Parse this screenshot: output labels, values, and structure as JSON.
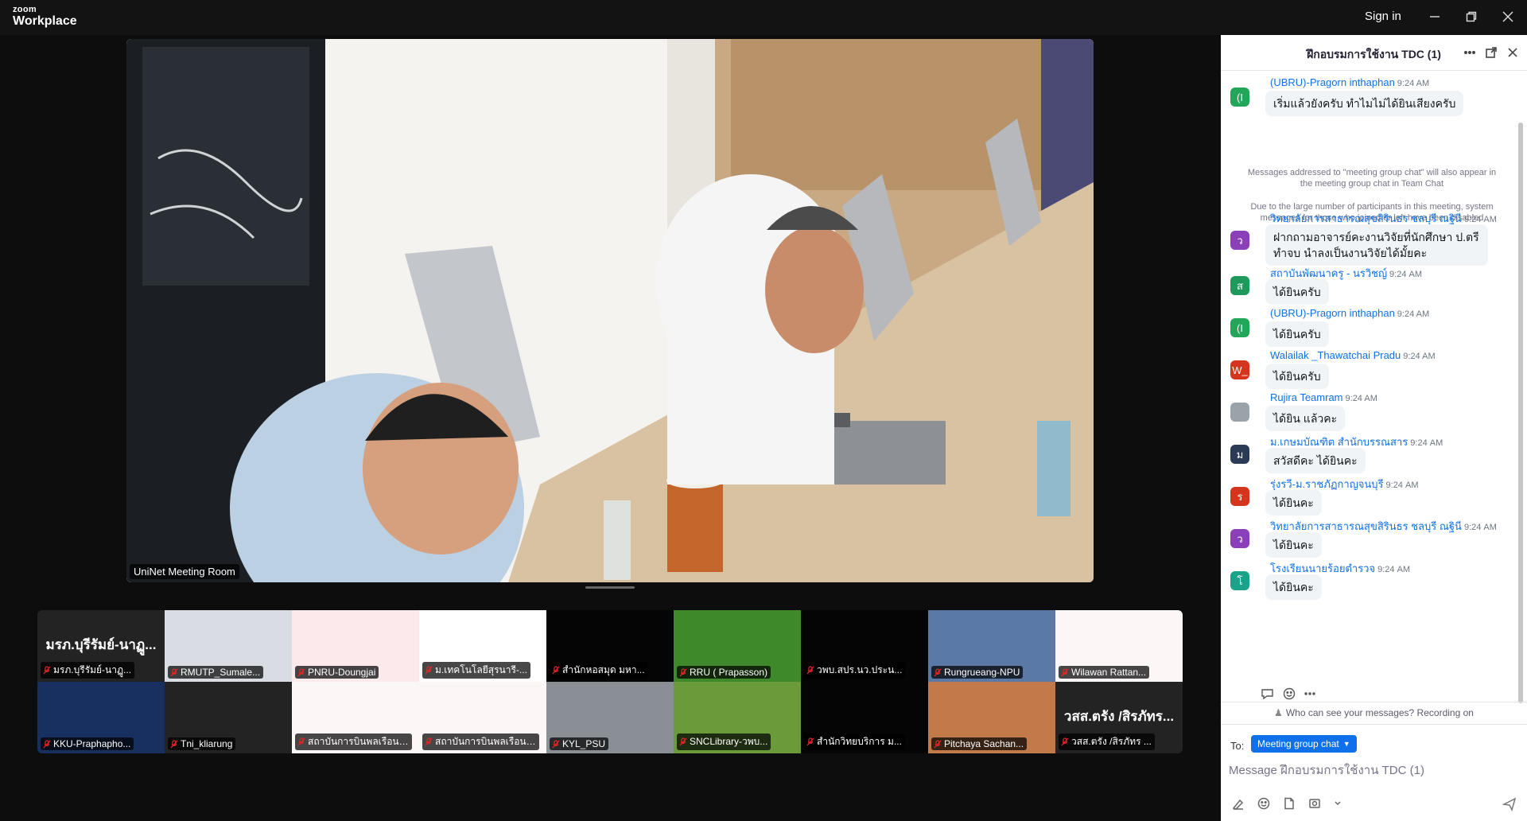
{
  "app": {
    "logo_top": "zoom",
    "logo_bottom": "Workplace",
    "signin_label": "Sign in"
  },
  "main_video": {
    "participant_name": "UniNet Meeting Room"
  },
  "gallery": [
    {
      "name": "มรภ.บุรีรัมย์-นาฏู...",
      "big": "มรภ.บุรีรัมย์-นาฏู...",
      "bg": "#232323"
    },
    {
      "name": "RMUTP_Sumale...",
      "big": "",
      "bg": "#d9dde3"
    },
    {
      "name": "PNRU-Doungjai",
      "big": "",
      "bg": "#fbe9ec"
    },
    {
      "name": "ม.เทคโนโลยีสุรนารี-...",
      "big": "",
      "bg": "#ffffff"
    },
    {
      "name": "สำนักหอสมุด มหา...",
      "big": "",
      "bg": "#050505"
    },
    {
      "name": "RRU ( Prapasson)",
      "big": "",
      "bg": "#3e8a2a"
    },
    {
      "name": "วพบ.สปร.นว.ประน...",
      "big": "",
      "bg": "#050505"
    },
    {
      "name": "Rungrueang-NPU",
      "big": "",
      "bg": "#5b79a6"
    },
    {
      "name": "Wilawan Rattan...",
      "big": "",
      "bg": "#fdf6f6"
    },
    {
      "name": "KKU-Praphapho...",
      "big": "",
      "bg": "#183060"
    },
    {
      "name": "Tni_kliarung",
      "big": "",
      "bg": "#232323"
    },
    {
      "name": "สถาบันการบินพลเรือน(STI...",
      "big": "",
      "bg": "#fdf6f6"
    },
    {
      "name": "สถาบันการบินพลเรือน (S...",
      "big": "",
      "bg": "#fdf6f6"
    },
    {
      "name": "KYL_PSU",
      "big": "",
      "bg": "#8a8f96"
    },
    {
      "name": "SNCLibrary-วพบ...",
      "big": "",
      "bg": "#6a9a3a"
    },
    {
      "name": "สำนักวิทยบริการ ม...",
      "big": "",
      "bg": "#050505"
    },
    {
      "name": "Pitchaya Sachan...",
      "big": "",
      "bg": "#c27a4a"
    },
    {
      "name": "วสส.ตรัง /สิรภัทร ...",
      "big": "วสส.ตรัง /สิรภัทร...",
      "bg": "#232323"
    }
  ],
  "chat": {
    "title": "ฝึกอบรมการใช้งาน TDC (1)",
    "messages": [
      {
        "sender": "(UBRU)-Pragorn inthaphan",
        "time": "9:24 AM",
        "text": "เริ่มแล้วยังครับ ทำไมไม่ได้ยินเสียงครับ",
        "avatar": "(I",
        "color": "#23a55a"
      },
      {
        "sender": "วิทยาลัยการสาธารณสุขสิรินธร ชลบุรี ณฐินี",
        "time": "9:24 AM",
        "text": "ฝากถามอาจารย์คะงานวิจัยที่นักศึกษา ป.ตรี ทำจบ นำลงเป็นงานวิจัยได้มั้ยคะ",
        "avatar": "ว",
        "color": "#8b3fb8"
      },
      {
        "sender": "สถาบันพัฒนาครู - นรวิชญ์",
        "time": "9:24 AM",
        "text": "ได้ยินครับ",
        "avatar": "ส",
        "color": "#1f9a5c"
      },
      {
        "sender": "(UBRU)-Pragorn inthaphan",
        "time": "9:24 AM",
        "text": "ได้ยินครับ",
        "avatar": "(I",
        "color": "#23a55a"
      },
      {
        "sender": "Walailak _Thawatchai Pradu",
        "time": "9:24 AM",
        "text": "ได้ยินครับ",
        "avatar": "W_",
        "color": "#d4351c"
      },
      {
        "sender": "Rujira Teamram",
        "time": "9:24 AM",
        "text": "ได้ยิน แล้วคะ",
        "avatar": "",
        "color": "#9aa3a9"
      },
      {
        "sender": "ม.เกษมบัณฑิต สำนักบรรณสาร",
        "time": "9:24 AM",
        "text": "สวัสดีคะ ได้ยินคะ",
        "avatar": "ม",
        "color": "#2b3a55"
      },
      {
        "sender": "รุ่งรวี-ม.ราชภัฏกาญจนบุรี",
        "time": "9:24 AM",
        "text": "ได้ยินคะ",
        "avatar": "ร",
        "color": "#d4351c"
      },
      {
        "sender": "วิทยาลัยการสาธารณสุขสิรินธร ชลบุรี ณฐินี",
        "time": "9:24 AM",
        "text": "ได้ยินคะ",
        "avatar": "ว",
        "color": "#8b3fb8"
      },
      {
        "sender": "โรงเรียนนายร้อยตำรวจ",
        "time": "9:24 AM",
        "text": "ได้ยินคะ",
        "avatar": "โ",
        "color": "#1aa38a"
      }
    ],
    "system_notice_1": "Messages addressed to \"meeting group chat\" will also appear in the meeting group chat in Team Chat",
    "system_notice_2": "Due to the large number of participants in this meeting, system messages for those who joined or left have been disabled",
    "who_can_see": "Who can see your messages? Recording on",
    "to_label": "To:",
    "to_target": "Meeting group chat",
    "input_placeholder": "Message ฝึกอบรมการใช้งาน TDC (1)"
  }
}
